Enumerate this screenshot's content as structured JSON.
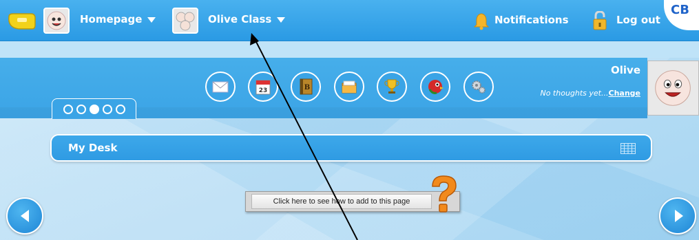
{
  "topbar": {
    "home_label": "Homepage",
    "class_label": "Olive Class",
    "notifications_label": "Notifications",
    "logout_label": "Log out",
    "logo_text": "CB"
  },
  "profile": {
    "name": "Olive",
    "thoughts": "No thoughts yet...",
    "change_label": "Change"
  },
  "icon_toolbar": [
    {
      "name": "mail-icon"
    },
    {
      "name": "calendar-icon",
      "text": "23"
    },
    {
      "name": "book-icon",
      "text": "B"
    },
    {
      "name": "files-icon"
    },
    {
      "name": "trophy-icon"
    },
    {
      "name": "parrot-icon"
    },
    {
      "name": "settings-icon"
    }
  ],
  "pager": {
    "total": 5,
    "active": 3
  },
  "desk": {
    "title": "My Desk"
  },
  "help": {
    "button_label": "Click here to see how to add to this page"
  },
  "colors": {
    "topbar": "#2a9ae4",
    "accent": "#3aa4e6",
    "background": "#bfe3f8"
  }
}
